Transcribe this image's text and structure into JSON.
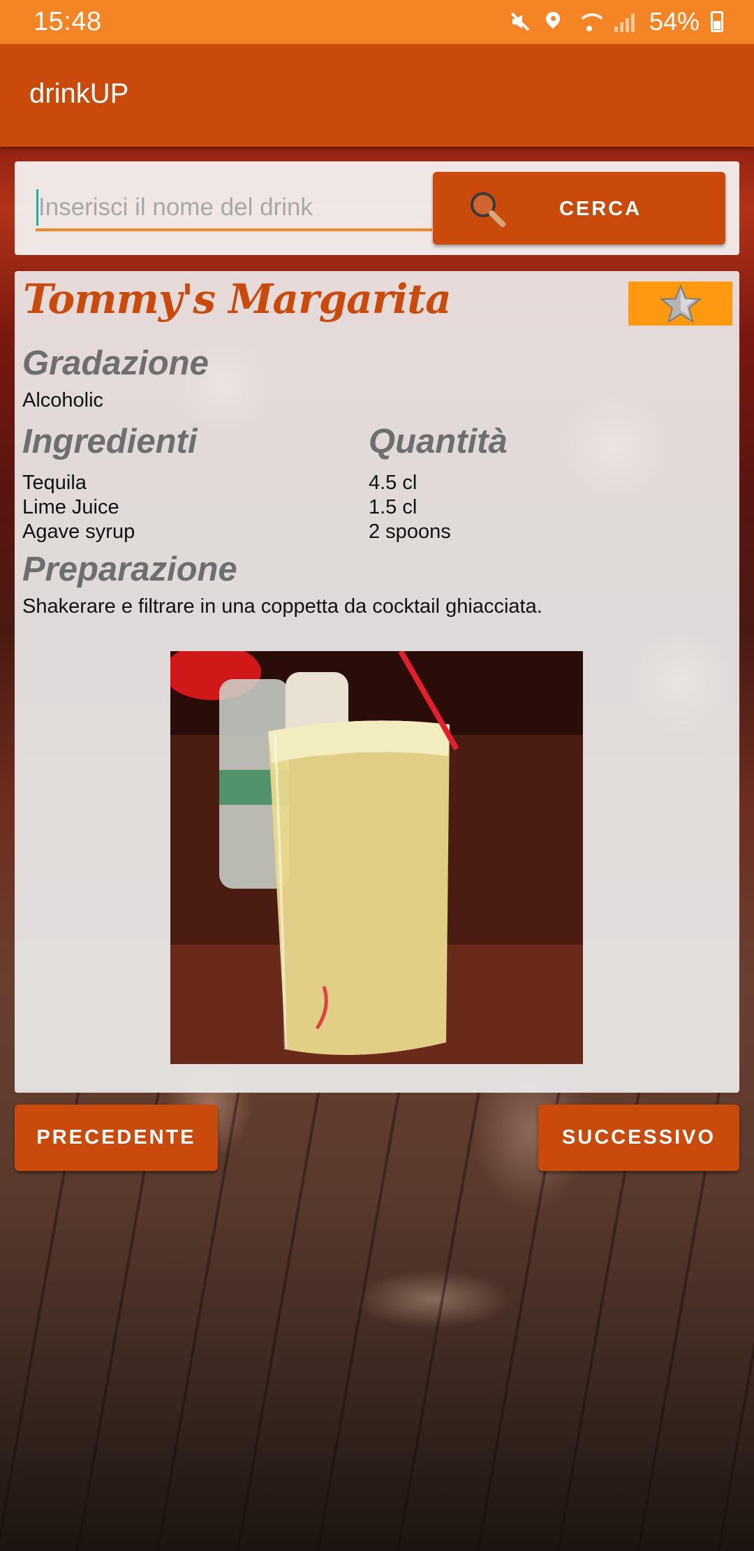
{
  "status_bar": {
    "time": "15:48",
    "battery": "54%",
    "battery_level": 0.54,
    "icons": [
      "mute-icon",
      "location-icon",
      "wifi-icon",
      "signal-icon",
      "battery-icon"
    ]
  },
  "app_bar": {
    "title": "drinkUP",
    "color": "#c94a0b"
  },
  "search": {
    "placeholder": "Inserisci il nome del drink",
    "value": "",
    "button_label": "CERCA",
    "button_icon": "search-icon"
  },
  "drink": {
    "name": "Tommy's Margarita",
    "favorite_icon": "star-icon",
    "gradazione_heading": "Gradazione",
    "gradazione": "Alcoholic",
    "ingredients_heading": "Ingredienti",
    "quantity_heading": "Quantità",
    "ingredients": [
      {
        "name": "Tequila",
        "quantity": "4.5 cl"
      },
      {
        "name": "Lime Juice",
        "quantity": "1.5 cl"
      },
      {
        "name": "Agave syrup",
        "quantity": "2 spoons"
      }
    ],
    "preparation_heading": "Preparazione",
    "preparation": "Shakerare e filtrare in una coppetta da cocktail ghiacciata."
  },
  "navigation": {
    "previous_label": "PRECEDENTE",
    "next_label": "SUCCESSIVO"
  },
  "colors": {
    "status_bar": "#f58524",
    "primary": "#c94a0b",
    "favorite": "#ff9910",
    "heading_grey": "#6e6e6e"
  }
}
